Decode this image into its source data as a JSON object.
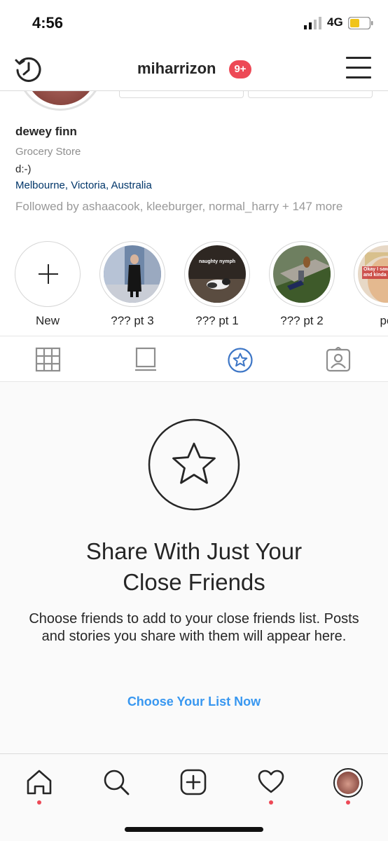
{
  "status_bar": {
    "time": "4:56",
    "network": "4G"
  },
  "nav": {
    "username": "miharrizon",
    "notification_count": "9+"
  },
  "profile": {
    "name": "dewey finn",
    "category": "Grocery Store",
    "bio": "d:-)",
    "location": "Melbourne, Victoria, Australia",
    "followed_by": "Followed by ashaacook, kleeburger, normal_harry + 147 more"
  },
  "highlights": [
    {
      "label": "New"
    },
    {
      "label": "??? pt 3"
    },
    {
      "label": "??? pt 1",
      "caption": "naughty nymph"
    },
    {
      "label": "??? pt 2"
    },
    {
      "label": "po",
      "caption": "Okay I saw do this and kinda enter"
    }
  ],
  "tabs": [
    {
      "icon": "grid-icon",
      "active": false
    },
    {
      "icon": "feed-icon",
      "active": false
    },
    {
      "icon": "close-friends-star-icon",
      "active": true
    },
    {
      "icon": "tagged-icon",
      "active": false
    }
  ],
  "empty_state": {
    "title_line1": "Share With Just Your",
    "title_line2": "Close Friends",
    "description": "Choose friends to add to your close friends list. Posts and stories you share with them will appear here.",
    "link": "Choose Your List Now"
  },
  "colors": {
    "accent": "#3897f0",
    "badge": "#ed4956",
    "location": "#003569"
  }
}
